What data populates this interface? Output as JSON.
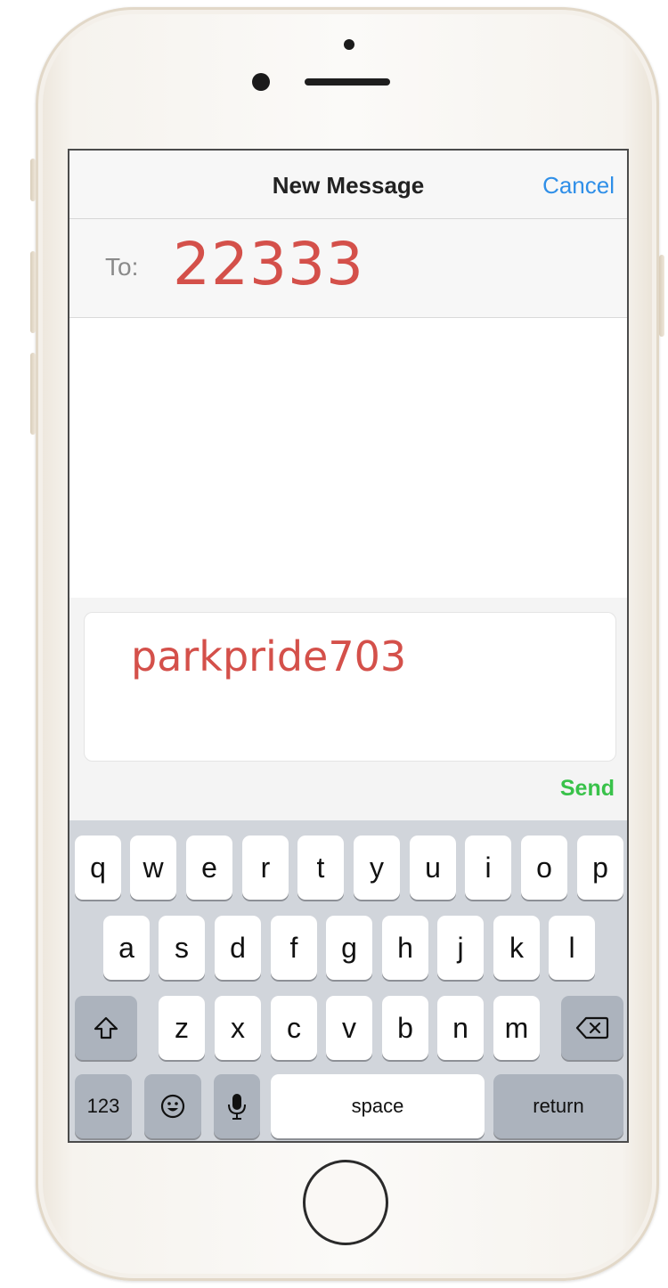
{
  "nav": {
    "title": "New Message",
    "cancel": "Cancel"
  },
  "recipient": {
    "label": "To:",
    "value": "22333"
  },
  "compose": {
    "text": "parkpride703",
    "send": "Send"
  },
  "keyboard": {
    "row1": [
      "q",
      "w",
      "e",
      "r",
      "t",
      "y",
      "u",
      "i",
      "o",
      "p"
    ],
    "row2": [
      "a",
      "s",
      "d",
      "f",
      "g",
      "h",
      "j",
      "k",
      "l"
    ],
    "row3": [
      "z",
      "x",
      "c",
      "v",
      "b",
      "n",
      "m"
    ],
    "numbers": "123",
    "space": "space",
    "return": "return",
    "icons": {
      "shift": "shift-icon",
      "delete": "backspace-icon",
      "emoji": "emoji-icon",
      "dictation": "microphone-icon"
    }
  },
  "colors": {
    "highlight": "#d4504a",
    "cancel": "#2f8fe8",
    "send": "#39c24a"
  }
}
